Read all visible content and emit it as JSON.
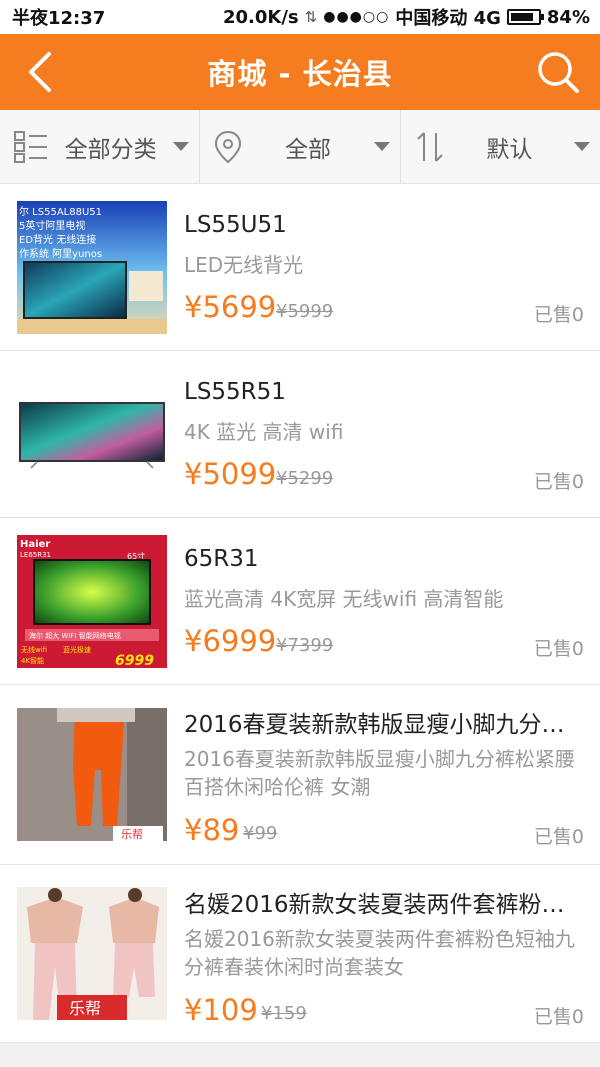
{
  "status_bar": {
    "time": "半夜12:37",
    "speed": "20.0K/s",
    "net_arrows": "⇅",
    "signal": "●●●○○",
    "carrier": "中国移动 4G",
    "battery_text": "84%",
    "battery_level": 0.84
  },
  "header": {
    "title": "商城 - 长治县",
    "back_icon": "chevron-left-icon",
    "search_icon": "search-icon"
  },
  "filters": [
    {
      "label": "全部分类",
      "icon": "category-grid-icon"
    },
    {
      "label": "全部",
      "icon": "location-pin-icon"
    },
    {
      "label": "默认",
      "icon": "sort-icon"
    }
  ],
  "colors": {
    "accent": "#f57c1f",
    "price": "#f57c1f"
  },
  "products": [
    {
      "name": "LS55U51",
      "desc": "LED无线背光",
      "price": "¥5699",
      "old_price": "¥5999",
      "sold": "已售0",
      "thumb_text": [
        "尔 LS55AL88U51",
        "5英寸阿里电视",
        "ED背光 无线连接",
        "作系统 阿里yunos"
      ]
    },
    {
      "name": "LS55R51",
      "desc": "4K 蓝光 高清 wifi",
      "price": "¥5099",
      "old_price": "¥5299",
      "sold": "已售0"
    },
    {
      "name": "65R31",
      "desc": "蓝光高清 4K宽屏 无线wifi 高清智能",
      "price": "¥6999",
      "old_price": "¥7399",
      "sold": "已售0",
      "thumb_text": [
        "Haier",
        "LE65R31",
        "65寸",
        "海尔 超大 WIFI 智能网络电视",
        "无线wifi",
        "蓝光极速",
        "4K智能",
        "6999"
      ]
    },
    {
      "name": "2016春夏装新款韩版显瘦小脚九分裤松紧腰百搭休闲哈伦裤 女潮",
      "desc": "2016春夏装新款韩版显瘦小脚九分裤松紧腰百搭休闲哈伦裤 女潮",
      "price": "¥89",
      "old_price": "¥99",
      "sold": "已售0",
      "thumb_text": [
        "乐帮"
      ]
    },
    {
      "name": "名媛2016新款女装夏装两件套裤粉色短袖九分裤春装休闲时尚套装女",
      "desc": "名媛2016新款女装夏装两件套裤粉色短袖九分裤春装休闲时尚套装女",
      "price": "¥109",
      "old_price": "¥159",
      "sold": "已售0",
      "thumb_text": [
        "乐帮"
      ]
    }
  ]
}
